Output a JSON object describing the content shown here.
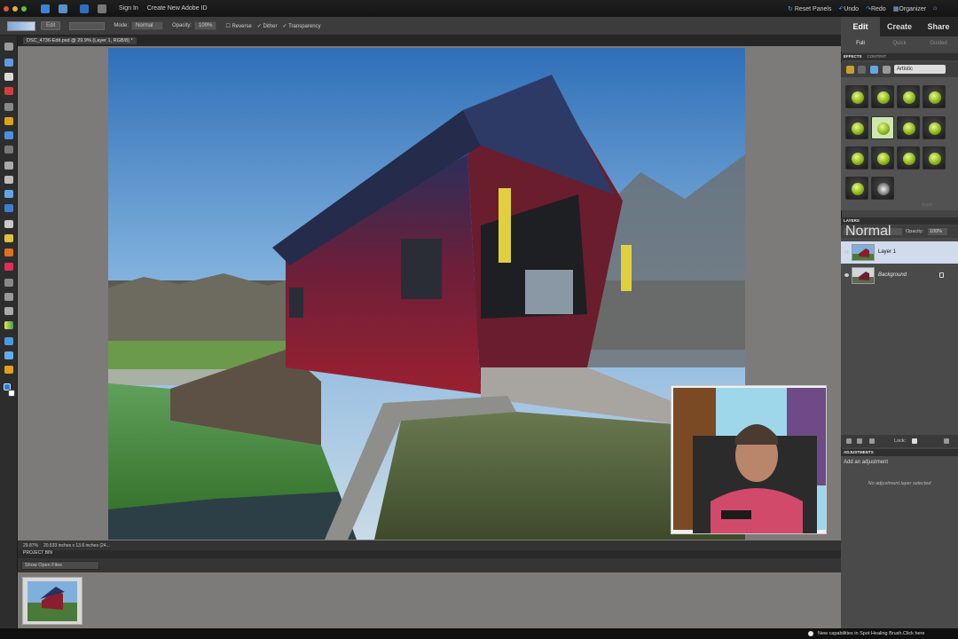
{
  "menubar": {
    "sign_in": "Sign In",
    "create_id": "Create New Adobe ID"
  },
  "rightbar": {
    "reset_panels": "Reset Panels",
    "undo": "Undo",
    "redo": "Redo",
    "organizer": "Organizer"
  },
  "options": {
    "edit_label": "Edit",
    "mode_label": "Mode:",
    "mode_value": "Normal",
    "opacity_label": "Opacity:",
    "opacity_value": "100%",
    "reverse": "Reverse",
    "dither": "Dither",
    "transparency": "Transparency"
  },
  "document": {
    "tab_title": "DSC_4736-Edit.psd @ 29.9% (Layer 1, RGB/8) *",
    "zoom": "29.87%",
    "dimensions": "20.533 inches x 13.6 inches (24..."
  },
  "project_bin": {
    "title": "PROJECT BIN",
    "show": "Show Open Files"
  },
  "status_message": "New capabilities in Spot Healing Brush.Click here",
  "mode_tabs": [
    "Edit",
    "Create",
    "Share"
  ],
  "sub_tabs": [
    "Full",
    "Quick",
    "Guided"
  ],
  "effects": {
    "title": "EFFECTS",
    "content": "CONTENT",
    "category": "Artistic",
    "apply": "Apply"
  },
  "layers": {
    "title": "LAYERS",
    "blend": "Normal",
    "opacity_label": "Opacity:",
    "opacity_value": "100%",
    "items": [
      "Layer 1",
      "Background"
    ],
    "lock_label": "Lock:"
  },
  "adjustments": {
    "title": "ADJUSTMENTS",
    "add": "Add an adjustment",
    "none": "No adjustment layer selected"
  },
  "colors": {
    "accent": "#4aa3ff",
    "selected_layer": "#d1dbee",
    "barn_red": "#8a1e2c"
  }
}
